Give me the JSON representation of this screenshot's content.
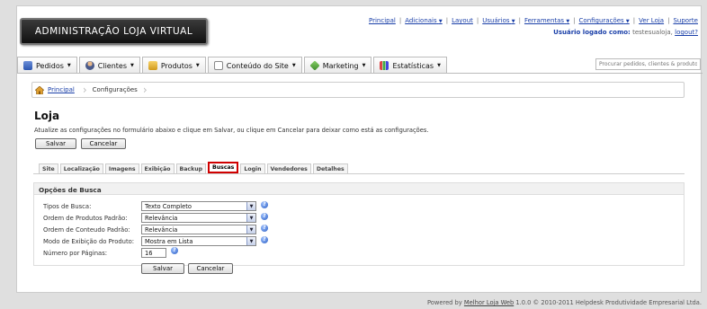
{
  "logo": "ADMINISTRAÇÃO LOJA VIRTUAL",
  "toplinks": {
    "principal": "Principal",
    "adicionais": "Adicionais",
    "layout": "Layout",
    "usuarios": "Usuários",
    "ferramentas": "Ferramentas",
    "configuracoes": "Configurações",
    "verloja": "Ver Loja",
    "suporte": "Suporte",
    "caret": "▼"
  },
  "user": {
    "label": "Usuário logado como:",
    "name": "testesualoja,",
    "logout": "logout?"
  },
  "nav": {
    "pedidos": "Pedidos",
    "clientes": "Clientes",
    "produtos": "Produtos",
    "conteudo": "Conteúdo do Site",
    "marketing": "Marketing",
    "estatisticas": "Estatísticas",
    "caret": "▼"
  },
  "search": {
    "placeholder": "Procurar pedidos, clientes & produtos"
  },
  "breadcrumb": {
    "home": "Principal",
    "current": "Configurações",
    "separator": "›"
  },
  "page": {
    "title": "Loja",
    "intro": "Atualize as configurações no formulário abaixo e clique em Salvar, ou clique em Cancelar para deixar como está as configurações."
  },
  "buttons": {
    "save": "Salvar",
    "cancel": "Cancelar"
  },
  "tabs": [
    "Site",
    "Localização",
    "Imagens",
    "Exibição",
    "Backup",
    "Buscas",
    "Login",
    "Vendedores",
    "Detalhes"
  ],
  "active_tab": "Buscas",
  "form": {
    "section_title": "Opções de Busca",
    "fields": [
      {
        "label": "Tipos de Busca:",
        "value": "Texto Completo"
      },
      {
        "label": "Ordem de Produtos Padrão:",
        "value": "Relevância"
      },
      {
        "label": "Ordem de Conteudo Padrão:",
        "value": "Relevância"
      },
      {
        "label": "Modo de Exibição do Produto:",
        "value": "Mostra em Lista"
      }
    ],
    "pages_label": "Número por Páginas:",
    "pages_value": "16",
    "help_glyph": "?"
  },
  "footer": {
    "prefix": "Powered by",
    "link": "Melhor Loja Web",
    "suffix": "1.0.0 © 2010-2011 Helpdesk Produtividade Empresarial Ltda."
  },
  "colors": {
    "accent_link": "#1a3fa8",
    "active_tab_border": "#d00000",
    "background": "#dfdfdf"
  }
}
